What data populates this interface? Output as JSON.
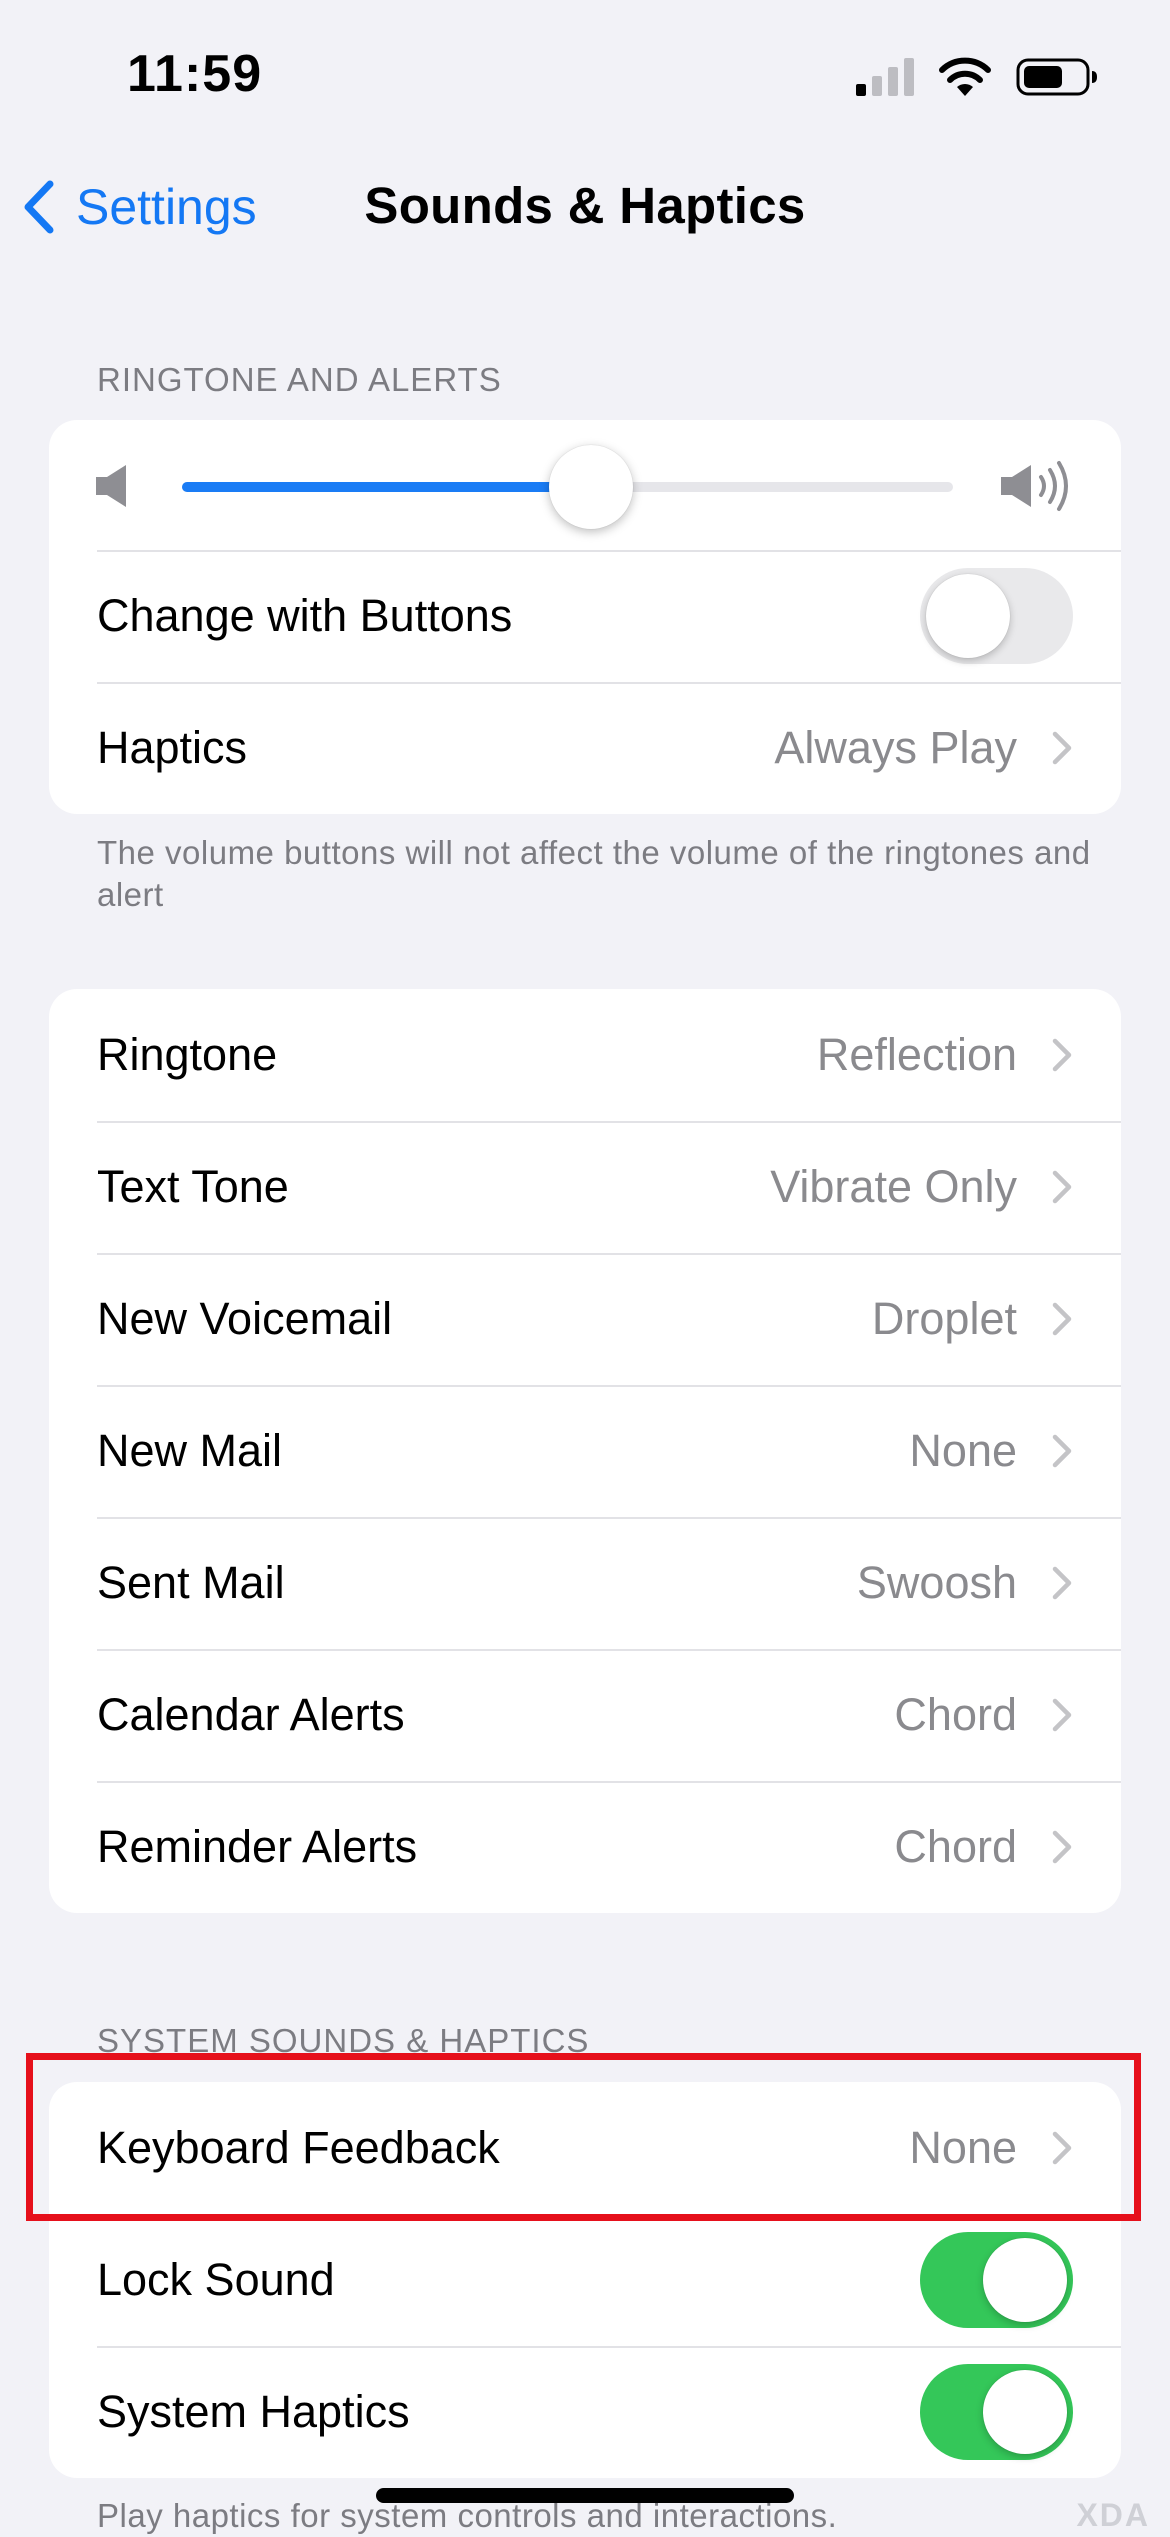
{
  "status_bar": {
    "time": "11:59"
  },
  "nav": {
    "back_label": "Settings",
    "title": "Sounds & Haptics"
  },
  "ringtone_alerts": {
    "header": "RINGTONE AND ALERTS",
    "volume_level": 0.53,
    "change_with_buttons": {
      "label": "Change with Buttons",
      "on": false
    },
    "haptics": {
      "label": "Haptics",
      "value": "Always Play"
    },
    "footer": "The volume buttons will not affect the volume of the ringtones and alert"
  },
  "tones": [
    {
      "label": "Ringtone",
      "value": "Reflection"
    },
    {
      "label": "Text Tone",
      "value": "Vibrate Only"
    },
    {
      "label": "New Voicemail",
      "value": "Droplet"
    },
    {
      "label": "New Mail",
      "value": "None"
    },
    {
      "label": "Sent Mail",
      "value": "Swoosh"
    },
    {
      "label": "Calendar Alerts",
      "value": "Chord"
    },
    {
      "label": "Reminder Alerts",
      "value": "Chord"
    }
  ],
  "system": {
    "header": "SYSTEM SOUNDS & HAPTICS",
    "keyboard_feedback": {
      "label": "Keyboard Feedback",
      "value": "None"
    },
    "lock_sound": {
      "label": "Lock Sound",
      "on": true
    },
    "system_haptics": {
      "label": "System Haptics",
      "on": true
    },
    "footer": "Play haptics for system controls and interactions."
  },
  "watermark": "XDA",
  "colors": {
    "accent": "#1478f4",
    "toggle_on": "#34c759",
    "highlight": "#e6101b"
  },
  "icons": [
    "cellular-signal-icon",
    "wifi-icon",
    "battery-icon",
    "chevron-left-icon",
    "speaker-low-icon",
    "speaker-high-icon",
    "chevron-right-icon"
  ]
}
